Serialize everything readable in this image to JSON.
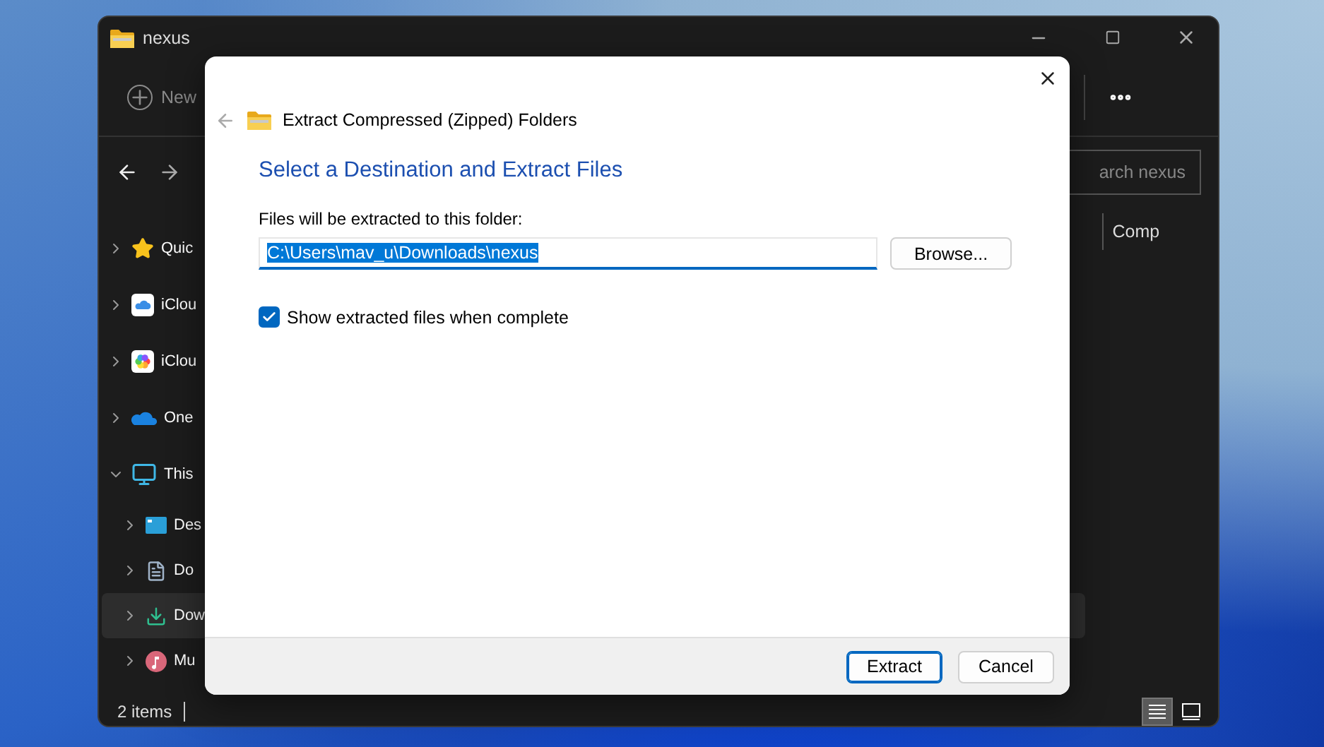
{
  "explorer": {
    "title": "nexus",
    "new_label": "New",
    "search": {
      "placeholder": "arch nexus"
    },
    "column_header": "Comp",
    "sidebar": [
      {
        "label": "Quic",
        "expanded": false,
        "selected": false
      },
      {
        "label": "iClou",
        "expanded": false,
        "selected": false
      },
      {
        "label": "iClou",
        "expanded": false,
        "selected": false
      },
      {
        "label": "One",
        "expanded": false,
        "selected": false
      },
      {
        "label": "This",
        "expanded": true,
        "selected": false,
        "children": [
          {
            "label": "Des",
            "expanded": false,
            "selected": false
          },
          {
            "label": "Do",
            "expanded": false,
            "selected": false
          },
          {
            "label": "Dow",
            "expanded": false,
            "selected": true
          },
          {
            "label": "Mu",
            "expanded": false,
            "selected": false
          }
        ]
      }
    ],
    "status": "2 items",
    "views": [
      {
        "selected": true
      },
      {
        "selected": false
      }
    ]
  },
  "dialog": {
    "title": "Extract Compressed (Zipped) Folders",
    "heading": "Select a Destination and Extract Files",
    "field_label": "Files will be extracted to this folder:",
    "path": {
      "value": "C:\\Users\\mav_u\\Downloads\\nexus",
      "text_selected": true
    },
    "browse": "Browse...",
    "show_files": {
      "label": "Show extracted files when complete",
      "checked": true
    },
    "buttons": [
      {
        "label": "Extract",
        "default": true
      },
      {
        "label": "Cancel",
        "default": false
      }
    ]
  }
}
